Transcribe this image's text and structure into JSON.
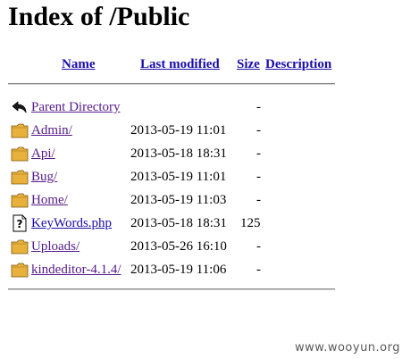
{
  "title": "Index of /Public",
  "columns": {
    "name": "Name",
    "last_modified": "Last modified",
    "size": "Size",
    "description": "Description"
  },
  "rows": [
    {
      "name": "Parent Directory",
      "date": "",
      "size": "-",
      "icon": "back-arrow-icon",
      "link_state": "visited"
    },
    {
      "name": "Admin/",
      "date": "2013-05-19 11:01",
      "size": "-",
      "icon": "folder-icon",
      "link_state": "visited"
    },
    {
      "name": "Api/",
      "date": "2013-05-18 18:31",
      "size": "-",
      "icon": "folder-icon",
      "link_state": "visited"
    },
    {
      "name": "Bug/",
      "date": "2013-05-19 11:01",
      "size": "-",
      "icon": "folder-icon",
      "link_state": "visited"
    },
    {
      "name": "Home/",
      "date": "2013-05-19 11:03",
      "size": "-",
      "icon": "folder-icon",
      "link_state": "visited"
    },
    {
      "name": "KeyWords.php",
      "date": "2013-05-18 18:31",
      "size": "125",
      "icon": "unknown-file-icon",
      "link_state": "unvisited"
    },
    {
      "name": "Uploads/",
      "date": "2013-05-26 16:10",
      "size": "-",
      "icon": "folder-icon",
      "link_state": "visited"
    },
    {
      "name": "kindeditor-4.1.4/",
      "date": "2013-05-19 11:06",
      "size": "-",
      "icon": "folder-icon",
      "link_state": "visited"
    }
  ],
  "colors": {
    "link": "#1a0dab",
    "visited_link": "#551a8b",
    "folder": "#e8b13c"
  },
  "watermark": "www.wooyun.org"
}
